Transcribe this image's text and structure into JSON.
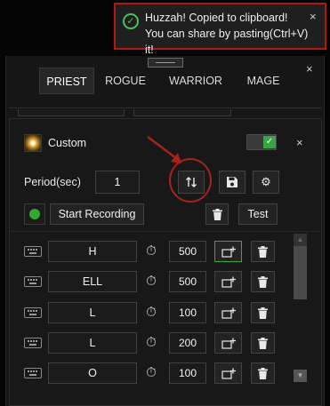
{
  "toast": {
    "message": "Huzzah! Copied to clipboard! You can share by pasting(Ctrl+V) it!",
    "icon": "check-circle-icon",
    "close": "×"
  },
  "panel": {
    "close": "×",
    "tabs": [
      {
        "label": "PRIEST",
        "active": true
      },
      {
        "label": "ROGUE",
        "active": false
      },
      {
        "label": "WARRIOR",
        "active": false
      },
      {
        "label": "MAGE",
        "active": false
      }
    ]
  },
  "macro": {
    "name": "Custom",
    "enabled": true,
    "close": "×",
    "period_label": "Period(sec)",
    "period_value": "1",
    "toolbar_icons": [
      "swap-vertical-icon",
      "save-icon",
      "gear-icon"
    ],
    "start_label": "Start Recording",
    "test_label": "Test",
    "rows": [
      {
        "key": "H",
        "delay": "500"
      },
      {
        "key": "ELL",
        "delay": "500"
      },
      {
        "key": "L",
        "delay": "100"
      },
      {
        "key": "L",
        "delay": "200"
      },
      {
        "key": "O",
        "delay": "100"
      }
    ]
  },
  "colors": {
    "accent_green": "#3ba545",
    "highlight_red": "#a8221c"
  }
}
